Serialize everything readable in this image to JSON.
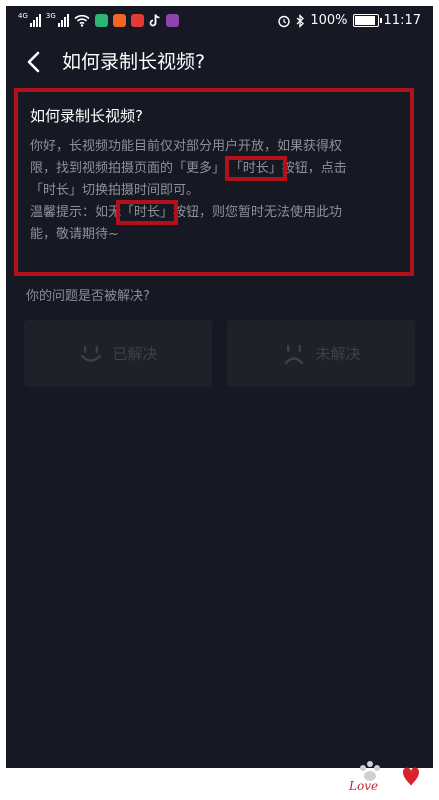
{
  "status_bar": {
    "signal1_label": "4G",
    "signal2_label": "3G",
    "battery": "100%",
    "time": "11:17",
    "battery_level": 1.0
  },
  "header": {
    "title": "如何录制长视频?"
  },
  "article": {
    "title": "如何录制长视频?",
    "body": {
      "line1": "你好，长视频功能目前仅对部分用户开放，如果获得权",
      "line2_pre": "限，找到视频拍摄页面的「更多」-",
      "line2_hl": "「时长」",
      "line2_post": "按钮，点击",
      "line3": "「时长」切换拍摄时间即可。",
      "line4_pre": "温馨提示：如无",
      "line4_hl": "「时长」",
      "line4_post": "按钮，则您暂时无法使用此功",
      "line5": "能，敬请期待~"
    }
  },
  "feedback": {
    "question": "你的问题是否被解决?",
    "solved_label": "已解决",
    "unsolved_label": "未解决"
  },
  "colors": {
    "background": "#161823",
    "highlight_border": "#b1111b",
    "button_bg": "#1f2129",
    "button_text": "#3e4049"
  }
}
